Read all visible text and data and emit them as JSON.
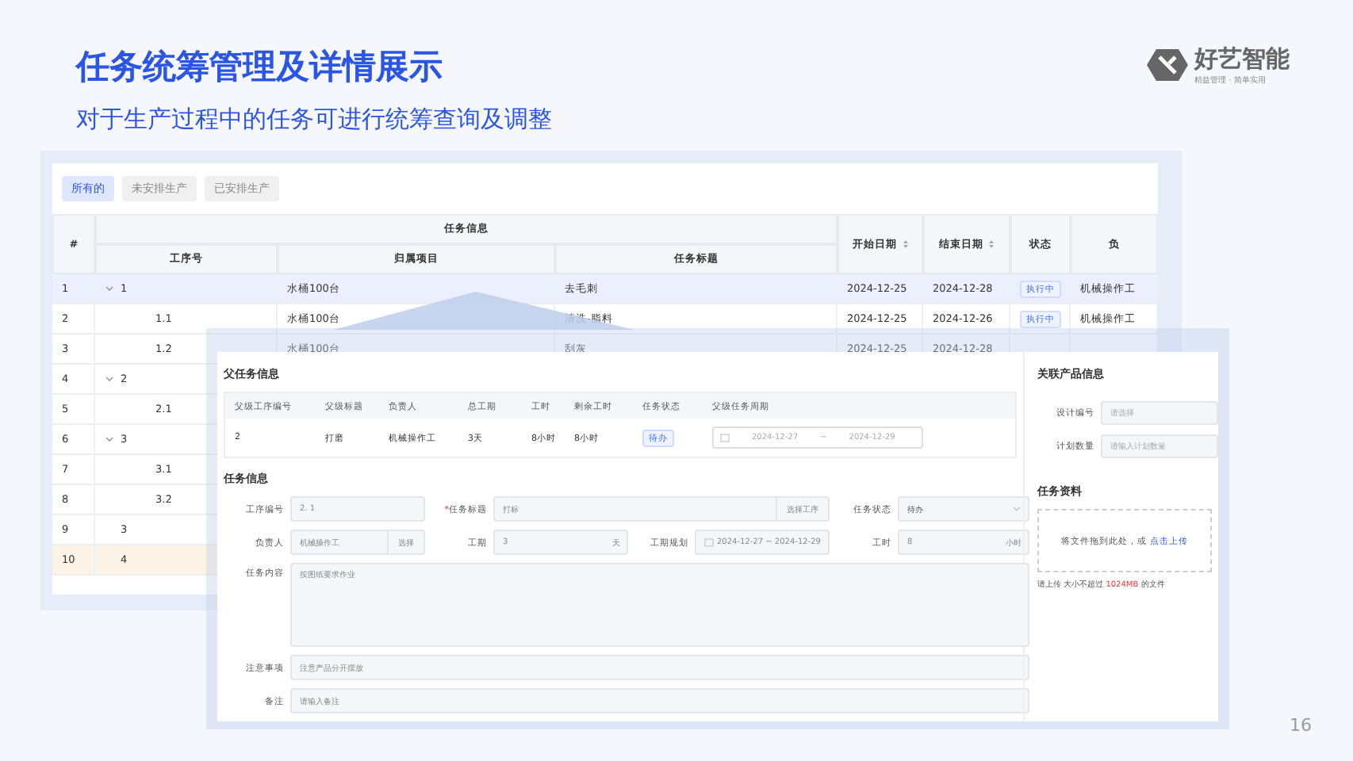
{
  "slide": {
    "title": "任务统筹管理及详情展示",
    "subtitle": "对于生产过程中的任务可进行统筹查询及调整",
    "page_number": "16"
  },
  "logo": {
    "name": "好艺智能",
    "tagline": "精益管理 · 简单实用"
  },
  "task_list": {
    "tabs": [
      {
        "label": "所有的",
        "selected": true
      },
      {
        "label": "未安排生产",
        "selected": false
      },
      {
        "label": "已安排生产",
        "selected": false
      }
    ],
    "index_header": "#",
    "group_header": "任务信息",
    "group_columns": [
      "工序号",
      "归属项目",
      "任务标题"
    ],
    "columns": [
      {
        "label": "开始日期",
        "sortable": true
      },
      {
        "label": "结束日期",
        "sortable": true
      },
      {
        "label": "状态",
        "sortable": false
      },
      {
        "label": "负",
        "sortable": false
      }
    ],
    "rows": [
      {
        "index": "1",
        "code": "1",
        "project": "水桶100台",
        "title": "去毛刺",
        "start": "2024-12-25",
        "end": "2024-12-28",
        "status": "执行中",
        "owner": "机械操作工",
        "selected": true,
        "highlighted": false,
        "expanded": true,
        "children": [
          {
            "index": "2",
            "code": "1.1",
            "project": "水桶100台",
            "title": "清洗-脂料",
            "start": "2024-12-25",
            "end": "2024-12-26",
            "status": "执行中",
            "owner": "机械操作工",
            "selected": false,
            "highlighted": false
          },
          {
            "index": "3",
            "code": "1.2",
            "project": "水桶100台",
            "title": "刮灰",
            "start": "2024-12-25",
            "end": "2024-12-28",
            "selected": false,
            "highlighted": false
          }
        ]
      },
      {
        "index": "4",
        "code": "2",
        "selected": false,
        "highlighted": false,
        "expanded": true,
        "children": [
          {
            "index": "5",
            "code": "2.1",
            "selected": false,
            "highlighted": false
          }
        ]
      },
      {
        "index": "6",
        "code": "3",
        "selected": false,
        "highlighted": false,
        "expanded": true,
        "children": [
          {
            "index": "7",
            "code": "3.1",
            "selected": false,
            "highlighted": false
          },
          {
            "index": "8",
            "code": "3.2",
            "selected": false,
            "highlighted": false
          }
        ]
      },
      {
        "index": "9",
        "code": "3",
        "selected": false,
        "highlighted": false
      },
      {
        "index": "10",
        "code": "4",
        "selected": false,
        "highlighted": true
      }
    ]
  },
  "task_detail": {
    "parent_info": {
      "title": "父任务信息",
      "columns": [
        "父级工序编号",
        "父级标题",
        "负责人",
        "总工期",
        "工时",
        "剩余工时",
        "任务状态",
        "父级任务周期"
      ],
      "cells": [
        {
          "kind": "text",
          "text": "2"
        },
        {
          "kind": "text",
          "text": "打磨"
        },
        {
          "kind": "text",
          "text": "机械操作工"
        },
        {
          "kind": "text",
          "text": "3天"
        },
        {
          "kind": "text",
          "text": "8小时"
        },
        {
          "kind": "text",
          "text": "8小时"
        },
        {
          "kind": "badge",
          "text": "待办"
        },
        {
          "kind": "range",
          "start": "2024-12-27",
          "separator": "~",
          "end": "2024-12-29"
        }
      ]
    },
    "task_info": {
      "title": "任务信息",
      "required_mark": "*",
      "fields": [
        {
          "kind": "text",
          "label": "工序编号",
          "value": "2. 1",
          "required": false
        },
        {
          "kind": "picker",
          "label": "任务标题",
          "value": "打标",
          "button": "选择工序",
          "required": true
        },
        {
          "kind": "select",
          "label": "任务状态",
          "value": "待办",
          "required": false
        },
        {
          "kind": "addon",
          "label": "负责人",
          "value": "机械操作工",
          "button": "选择",
          "required": false
        },
        {
          "kind": "suffix",
          "label": "工期",
          "value": "3",
          "suffix": "天",
          "required": false
        },
        {
          "kind": "range",
          "label": "工期规划",
          "value": "2024-12-27 ~ 2024-12-29",
          "required": false
        },
        {
          "kind": "suffix",
          "label": "工时",
          "value": "8",
          "suffix": "小时",
          "required": false
        },
        {
          "kind": "textarea",
          "label": "任务内容",
          "value": "按图纸要求作业",
          "required": false
        },
        {
          "kind": "line",
          "label": "注意事项",
          "value": "注意产品分开摆放",
          "required": false
        },
        {
          "kind": "line",
          "label": "备注",
          "placeholder": "请输入备注",
          "required": false
        }
      ]
    },
    "related_product": {
      "title": "关联产品信息",
      "fields": [
        {
          "label": "设计编号",
          "placeholder": "请选择"
        },
        {
          "label": "计划数量",
          "placeholder": "请输入计划数量"
        }
      ]
    },
    "materials": {
      "title": "任务资料",
      "drop_text": "将文件拖到此处，或",
      "drop_link": "点击上传",
      "hint_before": "请上传 大小不超过",
      "hint_size": "1024MB",
      "hint_after": "的文件"
    }
  }
}
